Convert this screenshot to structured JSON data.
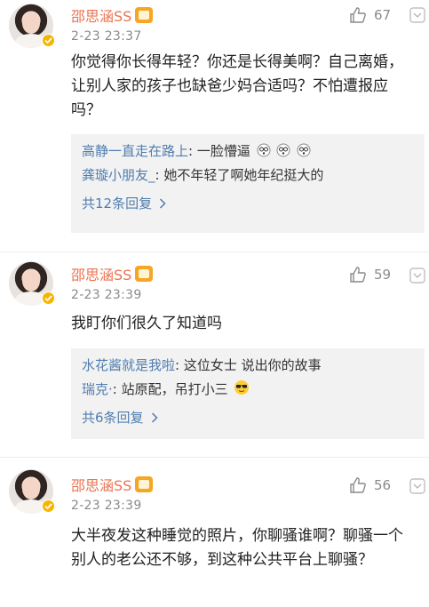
{
  "comments": [
    {
      "username": "邵思涵SS",
      "time": "2-23 23:37",
      "likes": "67",
      "text": "你觉得你长得年轻？你还是长得美啊？自己离婚，让别人家的孩子也缺爸少妈合适吗？不怕遭报应吗？",
      "replies": [
        {
          "user": "高静一直走在路上",
          "sep": ": ",
          "text": "一脸懵逼"
        },
        {
          "user": "龚璇小朋友_",
          "sep": ": ",
          "text": "她不年轻了啊她年纪挺大的"
        }
      ],
      "reply_total": "共12条回复"
    },
    {
      "username": "邵思涵SS",
      "time": "2-23 23:39",
      "likes": "59",
      "text": "我盯你们很久了知道吗",
      "replies": [
        {
          "user": "水花酱就是我啦",
          "sep": ": ",
          "text": "这位女士 说出你的故事"
        },
        {
          "user": "瑞克·",
          "sep": ": ",
          "text": "站原配，吊打小三"
        }
      ],
      "reply_total": "共6条回复"
    },
    {
      "username": "邵思涵SS",
      "time": "2-23 23:39",
      "likes": "56",
      "text": "大半夜发这种睡觉的照片，你聊骚谁啊？聊骚一个别人的老公还不够，到这种公共平台上聊骚？"
    }
  ],
  "colors": {
    "username": "#eb7350",
    "reply_user": "#507daf",
    "meta": "#8a8a8a",
    "reply_bg": "#f2f2f2",
    "verified_badge": "#f7b500"
  },
  "icons": [
    "avatar",
    "verified-icon",
    "vip-level-icon",
    "thumb-up-icon",
    "chevron-down-icon",
    "chevron-right-icon",
    "dizzy-face-emoji",
    "sunglasses-emoji"
  ]
}
